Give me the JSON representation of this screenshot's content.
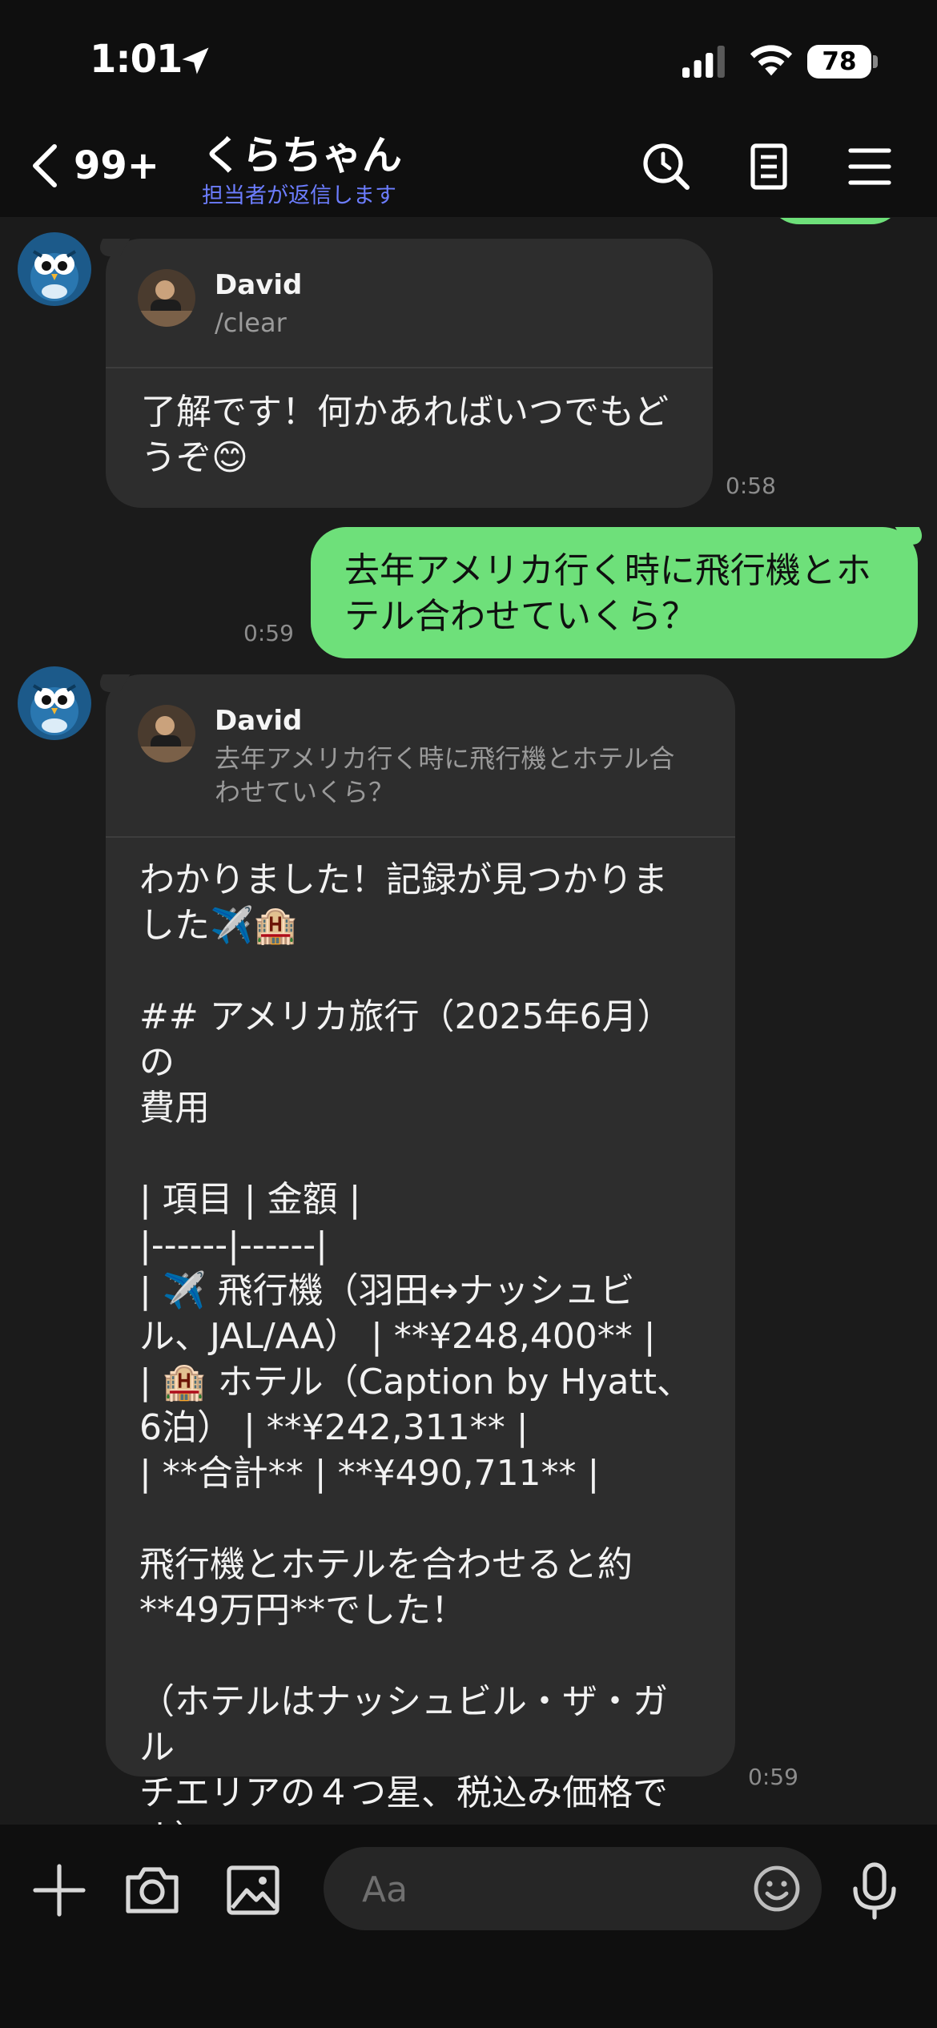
{
  "status_bar": {
    "time": "1:01",
    "battery": "78"
  },
  "header": {
    "unread_count": "99+",
    "title": "くらちゃん",
    "subtitle": "担当者が返信します"
  },
  "messages": [
    {
      "direction": "incoming",
      "quote_name": "David",
      "quote_text": "/clear",
      "text": "了解です！何かあればいつでもど\nうぞ😊",
      "time": "0:58"
    },
    {
      "direction": "outgoing",
      "text": "去年アメリカ行く時に飛行機とホ\nテル合わせていくら？",
      "time": "0:59"
    },
    {
      "direction": "incoming",
      "quote_name": "David",
      "quote_text": "去年アメリカ行く時に飛行機とホテル合\nわせていくら？",
      "text": "わかりました！記録が見つかりま\nした✈️🏨\n\n## アメリカ旅行（2025年6月）の\n費用\n\n| 項目 | 金額 |\n|------|------|\n| ✈️ 飛行機（羽田↔ナッシュビ\nル、JAL/AA） | **¥248,400** |\n| 🏨 ホテル（Caption by Hyatt、\n6泊） | **¥242,311** |\n| **合計** | **¥490,711** |\n\n飛行機とホテルを合わせると約\n**49万円**でした！\n\n（ホテルはナッシュビル・ザ・ガル\nチエリアの４つ星、税込み価格で\nす）",
      "time": "0:59"
    }
  ],
  "input": {
    "placeholder": "Aa"
  },
  "colors": {
    "outgoing_bubble": "#6ee07a",
    "incoming_bubble": "#2d2d2d",
    "subtitle": "#6c7dff",
    "background": "#1b1b1b"
  }
}
